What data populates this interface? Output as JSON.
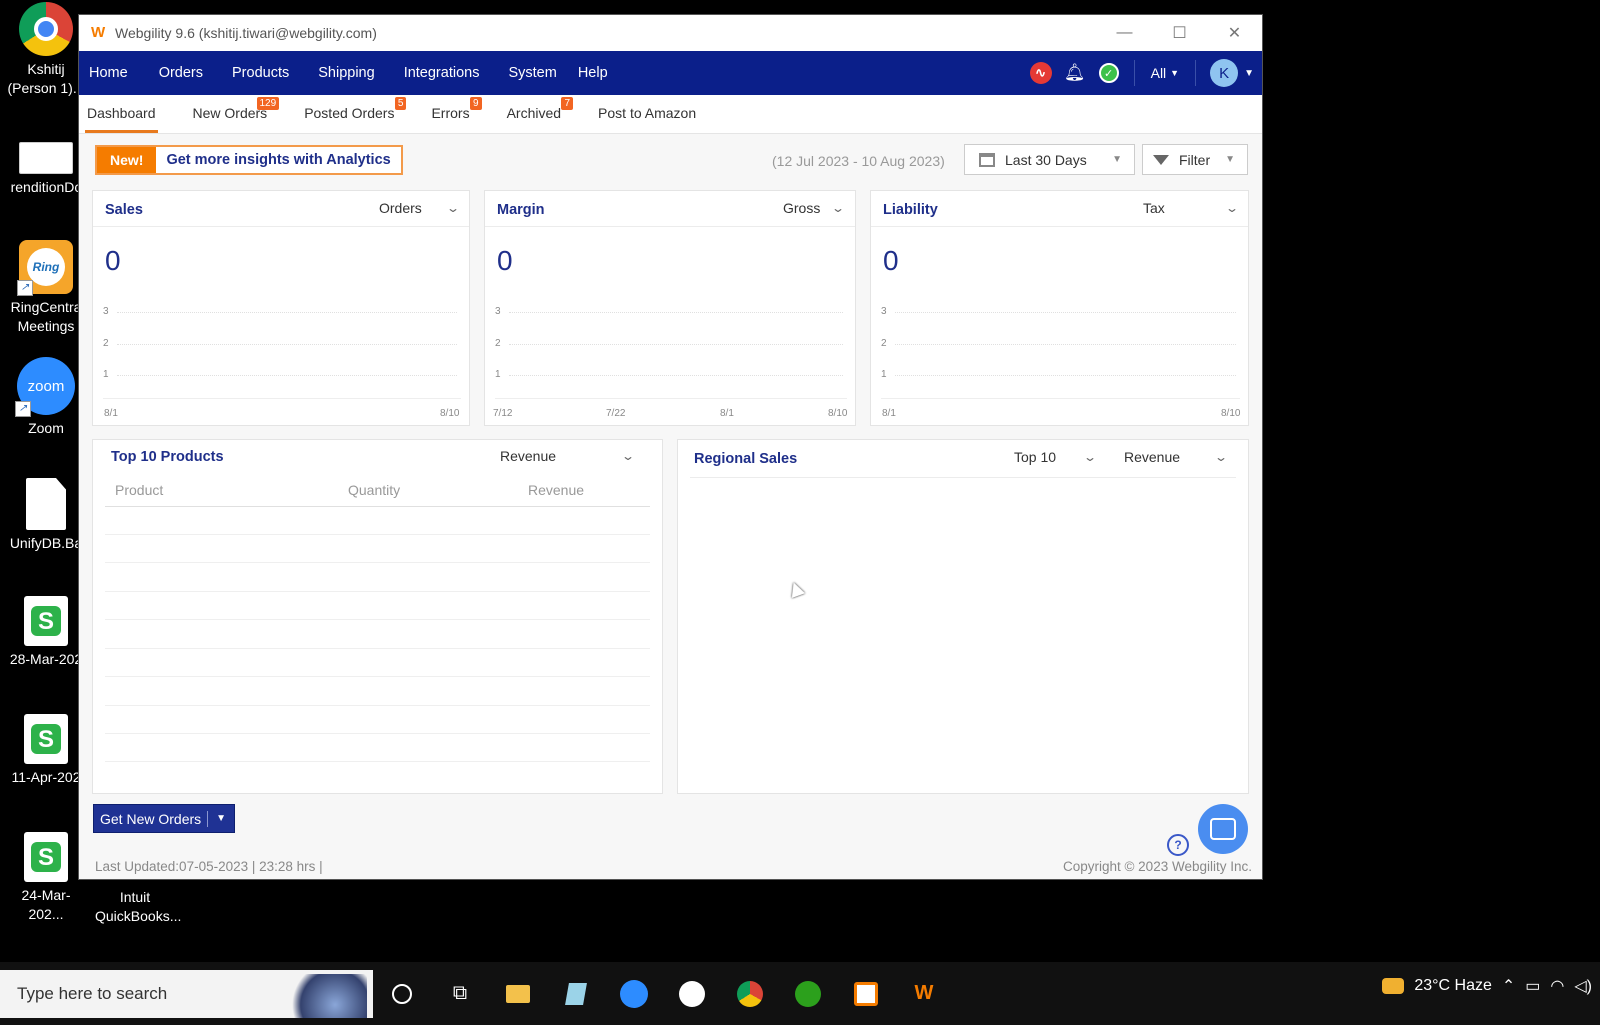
{
  "desktop": {
    "icons": [
      {
        "label": "Kshitij\n(Person 1)..."
      },
      {
        "label": "renditionDc"
      },
      {
        "label": "RingCentra\nMeetings"
      },
      {
        "label": "Zoom"
      },
      {
        "label": "UnifyDB.Ba"
      },
      {
        "label": "28-Mar-202"
      },
      {
        "label": "11-Apr-202"
      },
      {
        "label": "24-Mar-202..."
      },
      {
        "label": "Intuit\nQuickBooks..."
      }
    ],
    "ring_text": "Ring",
    "zoom_text": "zoom",
    "sheet_letter": "S"
  },
  "window": {
    "title": "Webgility 9.6 (kshitij.tiwari@webgility.com)",
    "controls": [
      "—",
      "☐",
      "✕"
    ]
  },
  "nav": {
    "items": [
      "Home",
      "Orders",
      "Products",
      "Shipping",
      "Integrations",
      "System",
      "Help"
    ],
    "all_label": "All",
    "avatar_letter": "K"
  },
  "subtabs": [
    {
      "label": "Dashboard",
      "badge": ""
    },
    {
      "label": "New Orders",
      "badge": "129"
    },
    {
      "label": "Posted Orders",
      "badge": "5"
    },
    {
      "label": "Errors",
      "badge": "9"
    },
    {
      "label": "Archived",
      "badge": "7"
    },
    {
      "label": "Post to Amazon",
      "badge": ""
    }
  ],
  "promo": {
    "new": "New!",
    "text": "Get more insights with Analytics"
  },
  "toolbar": {
    "daterange": "(12 Jul 2023 - 10 Aug 2023)",
    "period": "Last 30 Days",
    "filter": "Filter"
  },
  "cards": {
    "sales": {
      "title": "Sales",
      "dropdown": "Orders",
      "value": "0",
      "y_ticks": [
        "3",
        "2",
        "1"
      ],
      "x_ticks": [
        "8/1",
        "8/10"
      ]
    },
    "margin": {
      "title": "Margin",
      "dropdown": "Gross",
      "value": "0",
      "y_ticks": [
        "3",
        "2",
        "1"
      ],
      "x_ticks": [
        "7/12",
        "7/22",
        "8/1",
        "8/10"
      ]
    },
    "liability": {
      "title": "Liability",
      "dropdown": "Tax",
      "value": "0",
      "y_ticks": [
        "3",
        "2",
        "1"
      ],
      "x_ticks": [
        "8/1",
        "8/10"
      ]
    }
  },
  "top_products": {
    "title": "Top 10 Products",
    "dropdown": "Revenue",
    "columns": [
      "Product",
      "Quantity",
      "Revenue"
    ]
  },
  "regional": {
    "title": "Regional Sales",
    "dropdown_top": "Top 10",
    "dropdown_metric": "Revenue"
  },
  "actions": {
    "get_new_orders": "Get New Orders",
    "help": "?"
  },
  "footer": {
    "last_updated": "Last Updated:07-05-2023 | 23:28 hrs |",
    "copyright": "Copyright © 2023 Webgility Inc."
  },
  "taskbar": {
    "search_placeholder": "Type here to search",
    "weather": "23°C  Haze",
    "apps": [
      "cortana-icon",
      "task-view-icon",
      "file-explorer-icon",
      "notepad-icon",
      "zoom-icon",
      "slack-icon",
      "chrome-icon",
      "quickbooks-icon",
      "webgility-icon-2",
      "webgility-icon"
    ]
  },
  "colors": {
    "nav_bg": "#0b1f8a",
    "accent": "#f57c00",
    "title_blue": "#1f2f8a",
    "badge": "#f26522"
  }
}
